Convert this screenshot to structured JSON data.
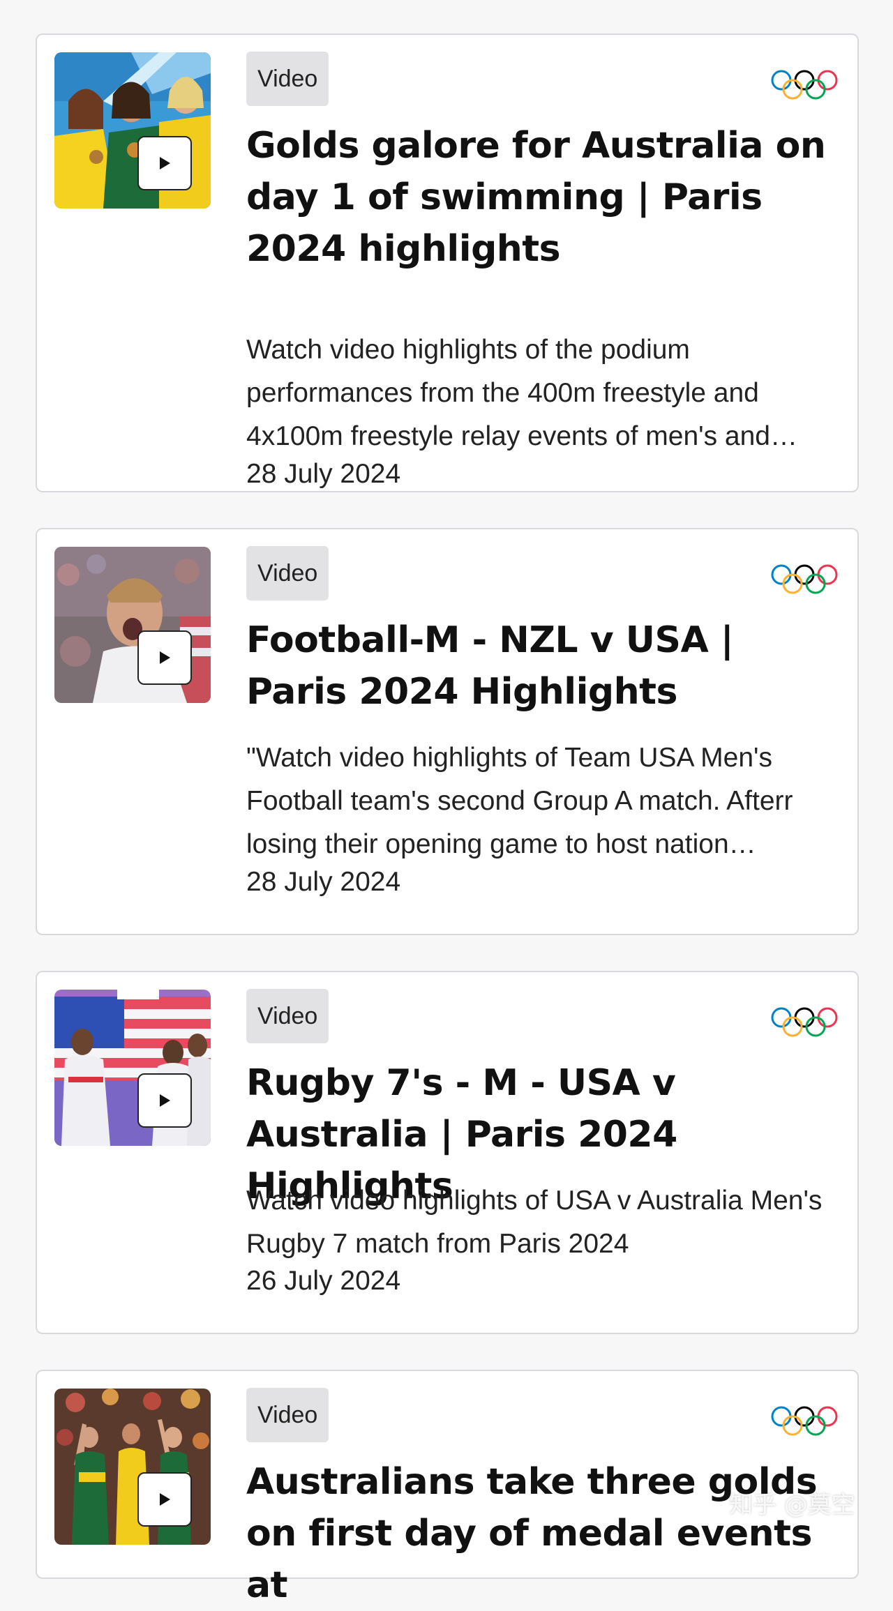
{
  "feed": {
    "items": [
      {
        "badge": "Video",
        "title": "Golds galore for Australia on day 1 of swimming | Paris 2024 highlights",
        "description": "Watch video highlights of the podium performances from the 400m freestyle and 4x100m freestyle relay events of men's and…",
        "date": "28 July 2024"
      },
      {
        "badge": "Video",
        "title": "Football-M - NZL v USA | Paris 2024 Highlights",
        "description": "\"Watch video highlights of Team USA Men's Football team's second Group A match. Afterr losing their opening game to host nation…",
        "date": "28 July 2024"
      },
      {
        "badge": "Video",
        "title": "Rugby 7's - M - USA v Australia | Paris 2024 Highlights",
        "description": "Watch video highlights of USA v Australia Men's Rugby 7 match from Paris 2024",
        "date": "26 July 2024"
      },
      {
        "badge": "Video",
        "title": "Australians take three golds on first day of medal events at"
      }
    ]
  },
  "icons": {
    "play": "play-icon",
    "rings": "olympic-rings-icon"
  },
  "colors": {
    "ring_blue": "#0081c8",
    "ring_yellow": "#fcb131",
    "ring_black": "#000000",
    "ring_green": "#00a651",
    "ring_red": "#ee334e",
    "card_border": "#d9d9dd",
    "badge_bg": "#e2e2e4"
  },
  "watermark": "知乎 @莫空"
}
